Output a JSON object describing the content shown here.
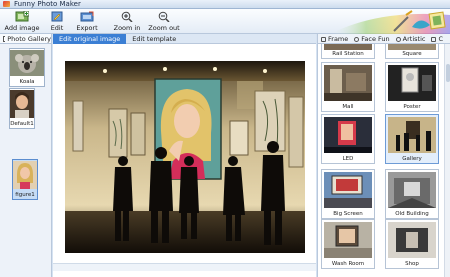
{
  "window": {
    "title": "Funny Photo Maker"
  },
  "toolbar": {
    "buttons": [
      {
        "label": "Add image",
        "icon": "add-image-icon"
      },
      {
        "label": "Edit",
        "icon": "edit-icon"
      },
      {
        "label": "Export",
        "icon": "export-icon"
      },
      {
        "label": "Zoom in",
        "icon": "zoom-in-icon"
      },
      {
        "label": "Zoom out",
        "icon": "zoom-out-icon"
      }
    ]
  },
  "gallery": {
    "tab_label": "Photo Gallery",
    "items": [
      {
        "label": "Koala",
        "selected": false
      },
      {
        "label": "Default1",
        "selected": false
      },
      {
        "label": "figure1",
        "selected": true
      }
    ]
  },
  "editor": {
    "tabs": [
      {
        "label": "Edit original image",
        "active": true
      },
      {
        "label": "Edit template",
        "active": false
      }
    ]
  },
  "templates": {
    "tabs": [
      {
        "label": "Frame",
        "icon": "frame-icon"
      },
      {
        "label": "Face Fun",
        "icon": "face-fun-icon"
      },
      {
        "label": "Artistic",
        "icon": "artistic-icon"
      },
      {
        "label": "C",
        "icon": "category-icon"
      }
    ],
    "items": [
      {
        "label": "Rail Station"
      },
      {
        "label": "Square"
      },
      {
        "label": "Mall"
      },
      {
        "label": "Poster"
      },
      {
        "label": "LED"
      },
      {
        "label": "Gallery",
        "selected": true
      },
      {
        "label": "Big Screen"
      },
      {
        "label": "Old Building"
      },
      {
        "label": "Wash Room"
      },
      {
        "label": "Shop"
      }
    ]
  },
  "colors": {
    "accent": "#3b7fd4",
    "panel": "#edf2f9",
    "border": "#b9c8dc"
  }
}
